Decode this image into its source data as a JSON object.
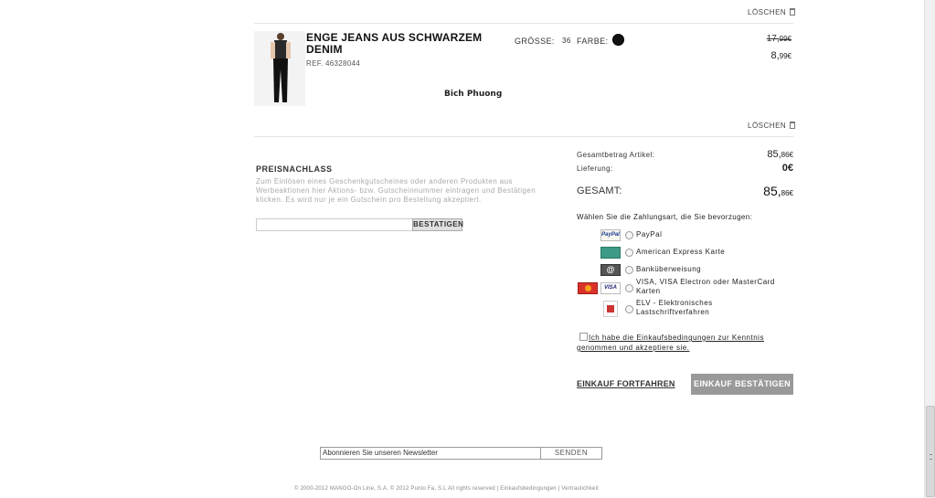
{
  "cart": {
    "delete_label_top": "LÖSCHEN",
    "delete_label_bottom": "LÖSCHEN",
    "item": {
      "title": "ENGE JEANS AUS SCHWARZEM DENIM",
      "ref": "REF. 46328044",
      "size_label": "GRÖSSE:",
      "size_value": "36",
      "color_label": "FARBE:",
      "color_hex": "#111111",
      "old_price_main": "17,",
      "old_price_cents": "99€",
      "price_main": "8,",
      "price_cents": "99€",
      "personalization": "Bich Phuong"
    }
  },
  "discount": {
    "title": "PREISNACHLASS",
    "help_text": "Zum Einlösen eines Geschenkgutscheines oder anderen Produkten aus Werbeaktionen hier Aktions- bzw. Gutscheinnummer eintragen und Bestätigen klicken. Es wird nur je ein Gutschein pro Bestellung akzeptiert.",
    "input_value": "",
    "confirm_label": "BESTATIGEN"
  },
  "summary": {
    "items_label": "Gesamtbetrag Artikel:",
    "items_main": "85,",
    "items_cents": "86€",
    "delivery_label": "Lieferung:",
    "delivery_value": "0€",
    "total_label": "GESAMT:",
    "total_main": "85,",
    "total_cents": "86€"
  },
  "payment": {
    "prompt": "Wählen Sie die Zahlungsart, die Sie bevorzugen:",
    "options": [
      {
        "label": "PayPal",
        "icon": "paypal-icon"
      },
      {
        "label": "American Express Karte",
        "icon": "amex-icon"
      },
      {
        "label": "Banküberweisung",
        "icon": "bank-transfer-icon"
      },
      {
        "label": "VISA, VISA Electron oder MasterCard Karten",
        "icon": "visa-mastercard-icon"
      },
      {
        "label": "ELV - Elektronisches Lastschriftverfahren",
        "icon": "elv-icon"
      }
    ],
    "icon_texts": {
      "paypal": "PayPal",
      "amex": "",
      "bank": "@",
      "visa": "VISA"
    }
  },
  "terms": {
    "label": "Ich habe die Einkaufsbedingungen zur Kenntnis genommen und akzeptiere sie."
  },
  "actions": {
    "continue_label": "EINKAUF FORTFAHREN",
    "confirm_label": "EINKAUF BESTÄTIGEN"
  },
  "newsletter": {
    "input_value": "Abonnieren Sie unseren Newsletter",
    "button_label": "SENDEN"
  },
  "footer": {
    "text": "© 2000-2012 MANGO-On Line, S.A. © 2012 Punto Fa, S.L All rights reserved | Einkaufsbedingungen | Vertraulichkeit"
  },
  "colors": {
    "confirm_button": "#999999",
    "swatch": "#111111"
  }
}
